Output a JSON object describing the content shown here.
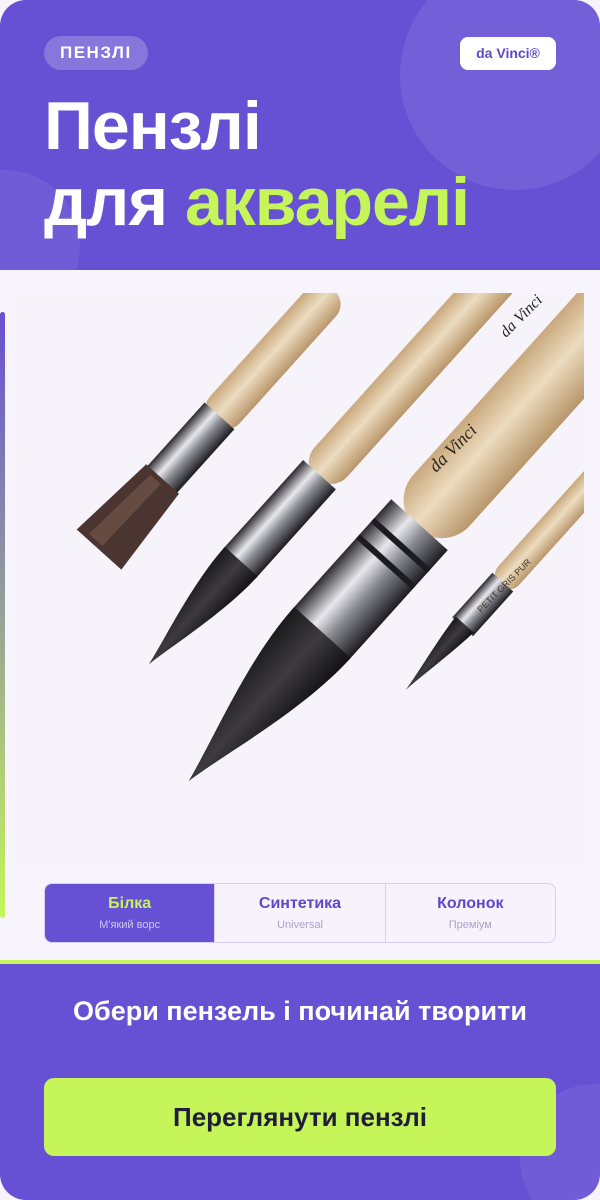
{
  "header": {
    "tag": "ПЕНЗЛІ",
    "brand": "da Vinci®",
    "title_line1": "Пензлі",
    "title_line2_prefix": "для ",
    "title_line2_accent": "акварелі"
  },
  "product_image": {
    "alt": "Пензлі da Vinci",
    "brush_inscriptions": [
      "da Vinci",
      "da Vinci",
      "PETIT GRIS PUR"
    ]
  },
  "tabs": [
    {
      "label": "Білка",
      "sublabel": "М'який ворс",
      "active": true
    },
    {
      "label": "Синтетика",
      "sublabel": "Universal",
      "active": false
    },
    {
      "label": "Колонок",
      "sublabel": "Преміум",
      "active": false
    }
  ],
  "footer": {
    "tagline": "Обери пензель і починай творити",
    "button_label": "Переглянути пензлі"
  },
  "colors": {
    "primary": "#6650d3",
    "accent": "#c6f55a",
    "background": "#f7f4fd",
    "button_text": "#1f1d3a"
  }
}
